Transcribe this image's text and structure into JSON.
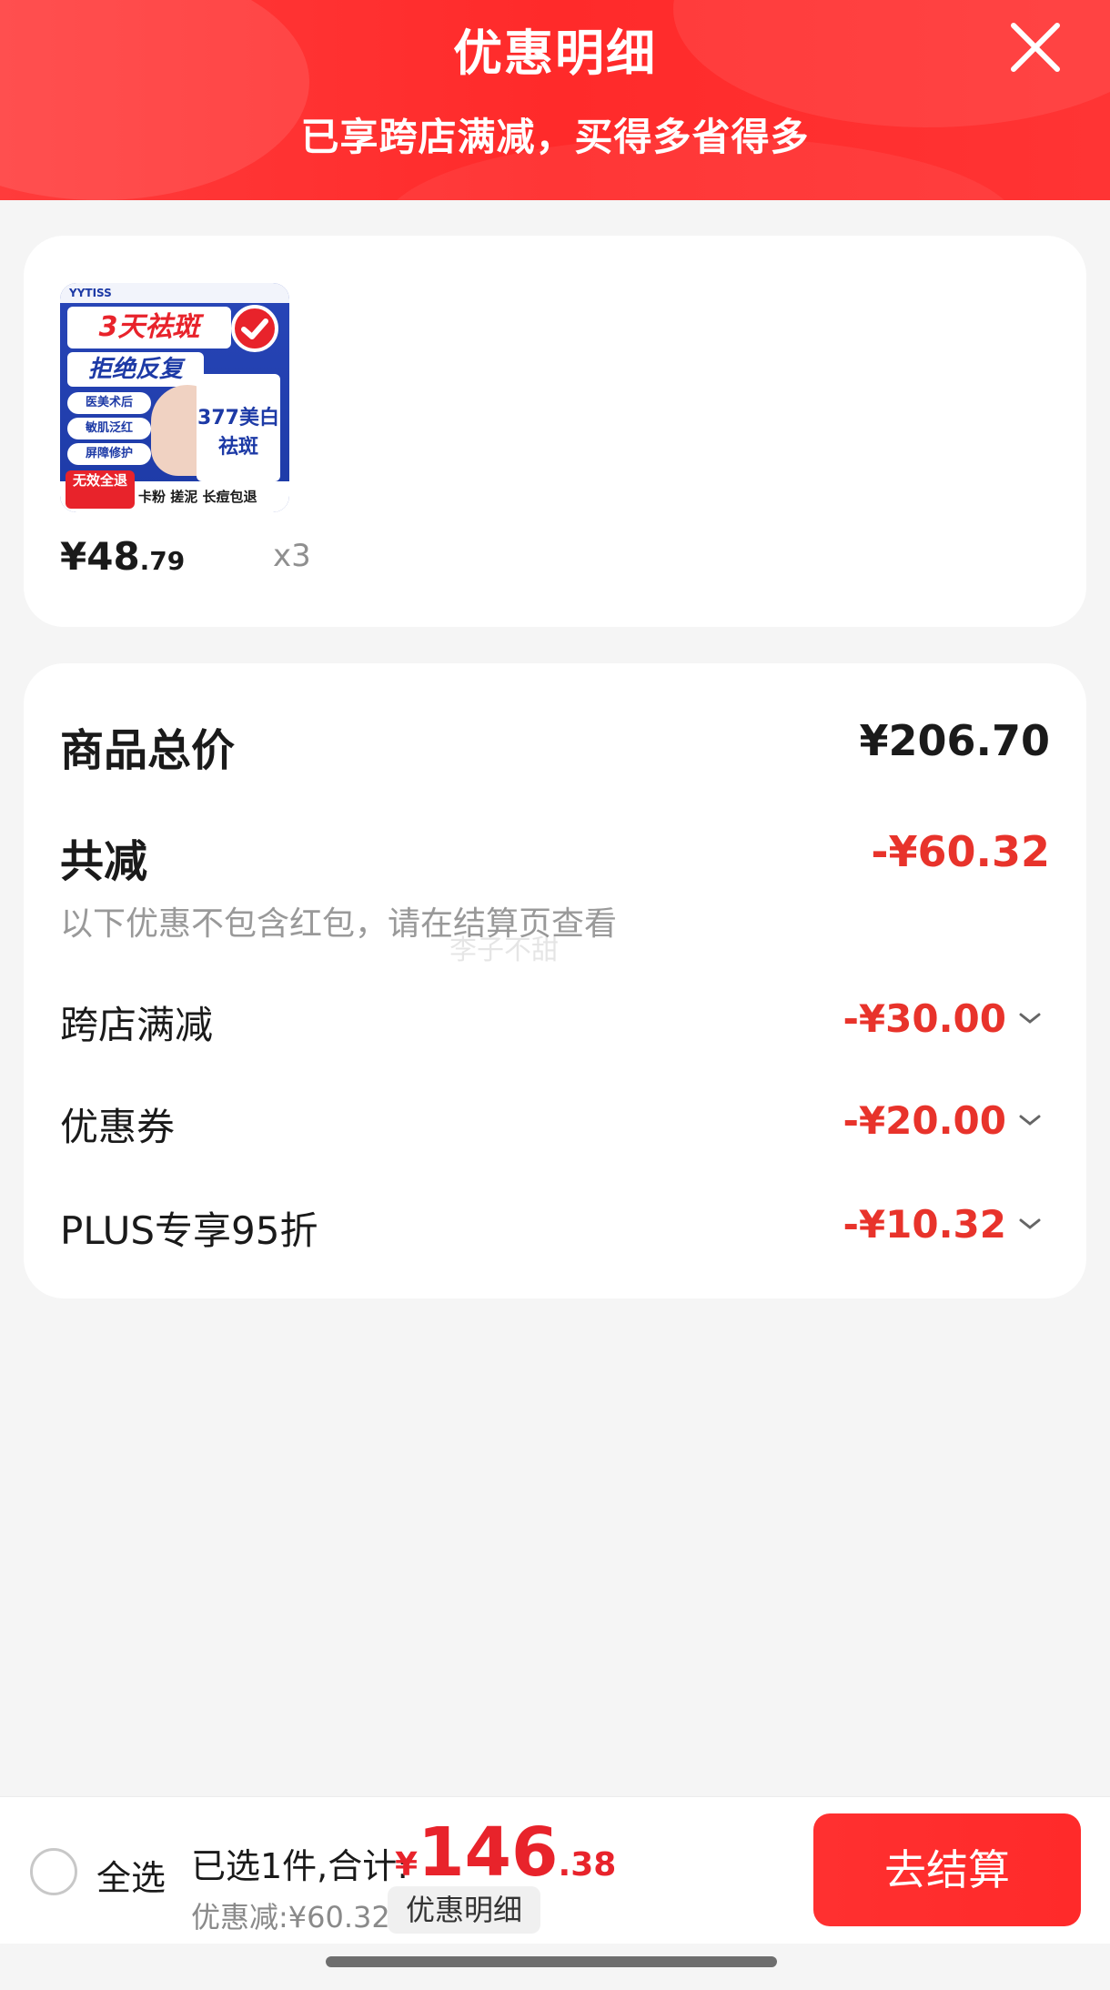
{
  "header": {
    "title": "优惠明细",
    "subtitle": "已享跨店满减，买得多省得多",
    "close_icon": "close-icon"
  },
  "product": {
    "image": {
      "brand": "YYTISS",
      "headline": "3天祛斑",
      "subhead": "拒绝反复",
      "tags": [
        "医美术后",
        "敏肌泛红",
        "屏障修护"
      ],
      "box_text": "377美白祛斑",
      "badge": "无效全退",
      "bottom_text": "卡粉 搓泥 长痘包退"
    },
    "price_main": "¥48",
    "price_cents": ".79",
    "quantity": "x3"
  },
  "summary": {
    "total_label": "商品总价",
    "total_value": "¥206.70",
    "discount_label": "共减",
    "discount_value": "-¥60.32",
    "note": "以下优惠不包含红包，请在结算页查看",
    "watermark": "李子不甜",
    "items": [
      {
        "label": "跨店满减",
        "value": "-¥30.00"
      },
      {
        "label": "优惠券",
        "value": "-¥20.00"
      },
      {
        "label": "PLUS专享95折",
        "value": "-¥10.32"
      }
    ],
    "accent_color": "#e8332b"
  },
  "bottom_bar": {
    "select_all": "全选",
    "selected_text": "已选1件,合计:",
    "total_yen": "¥",
    "total_int": "146",
    "total_dec": ".38",
    "saved_text": "优惠减:¥60.32",
    "detail_chip": "优惠明细",
    "checkout": "去结算"
  }
}
